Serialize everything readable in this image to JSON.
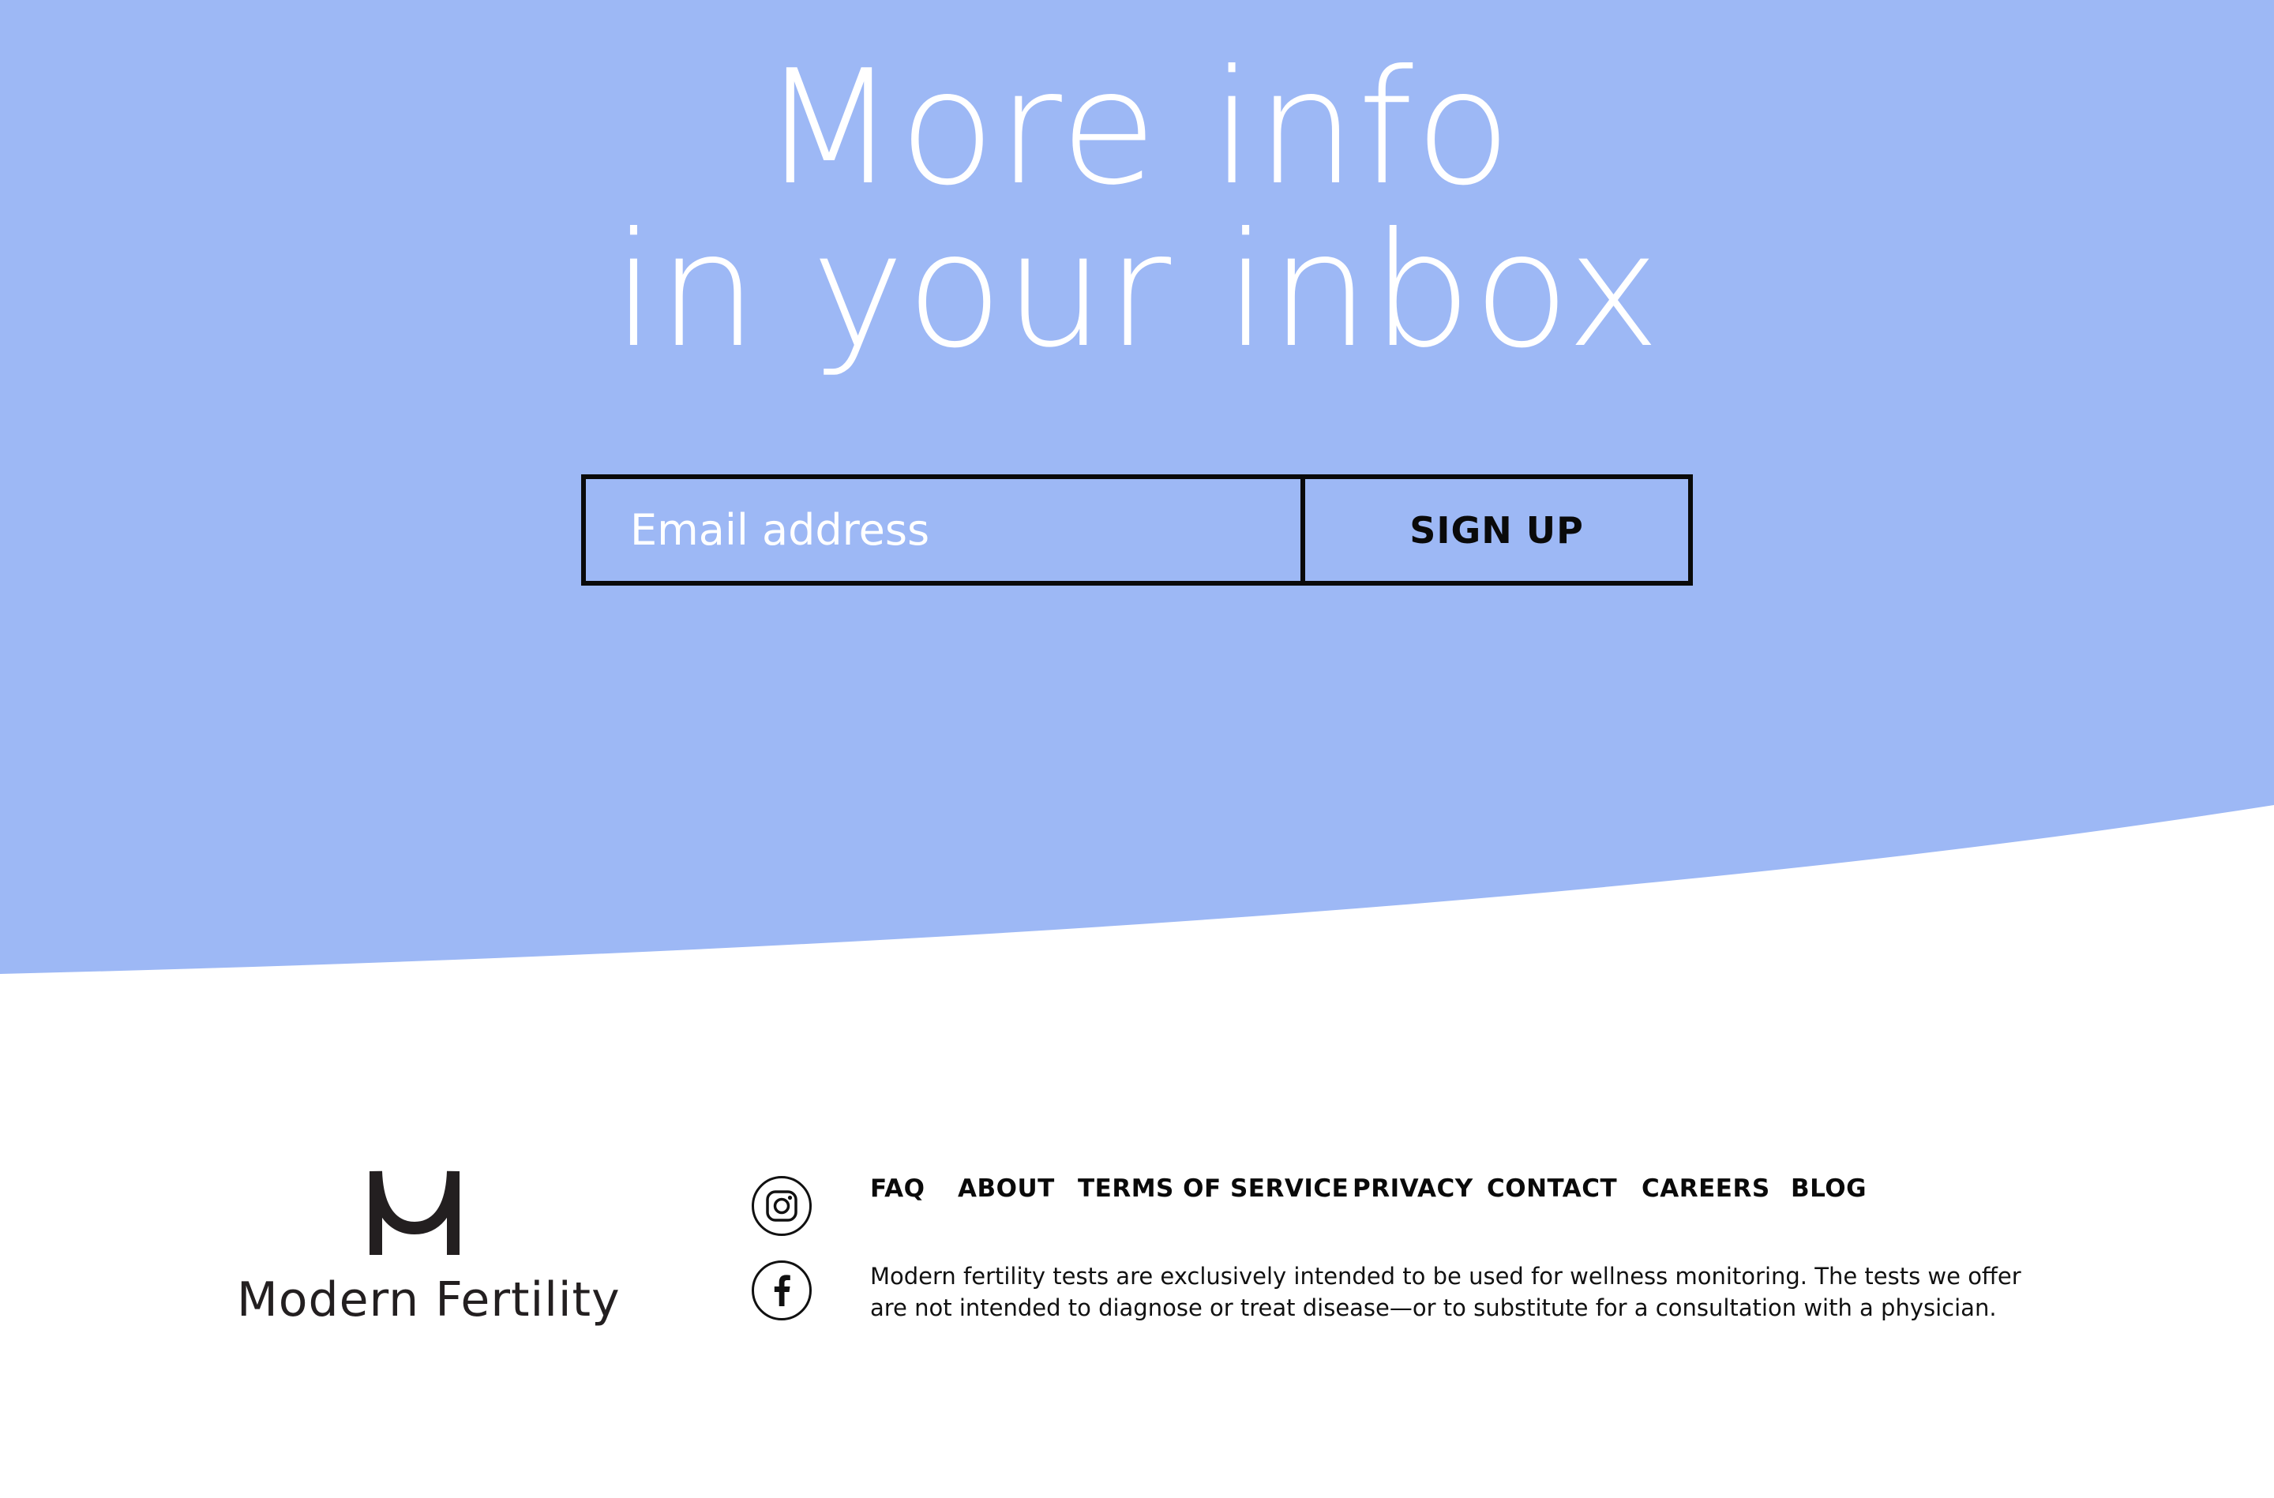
{
  "hero": {
    "headline_line1": "More info",
    "headline_line2": "in your inbox",
    "background_color": "#9db8f5"
  },
  "signup": {
    "email_placeholder": "Email address",
    "email_value": "",
    "button_label": "SIGN UP"
  },
  "footer": {
    "brand": {
      "name": "Modern Fertility",
      "mark_icon": "modern-fertility-m-logo-icon"
    },
    "social": [
      {
        "name": "instagram",
        "icon": "instagram-icon"
      },
      {
        "name": "facebook",
        "icon": "facebook-icon"
      }
    ],
    "nav": {
      "faq": "FAQ",
      "about": "ABOUT",
      "terms": "TERMS OF SERVICE",
      "privacy": "PRIVACY",
      "contact": "CONTACT",
      "careers": "CAREERS",
      "blog": "BLOG"
    },
    "disclaimer_line1": "Modern fertility tests are exclusively intended to be used for wellness monitoring. The tests we offer",
    "disclaimer_line2": "are not intended to diagnose or treat disease—or to substitute for a consultation with a physician."
  }
}
